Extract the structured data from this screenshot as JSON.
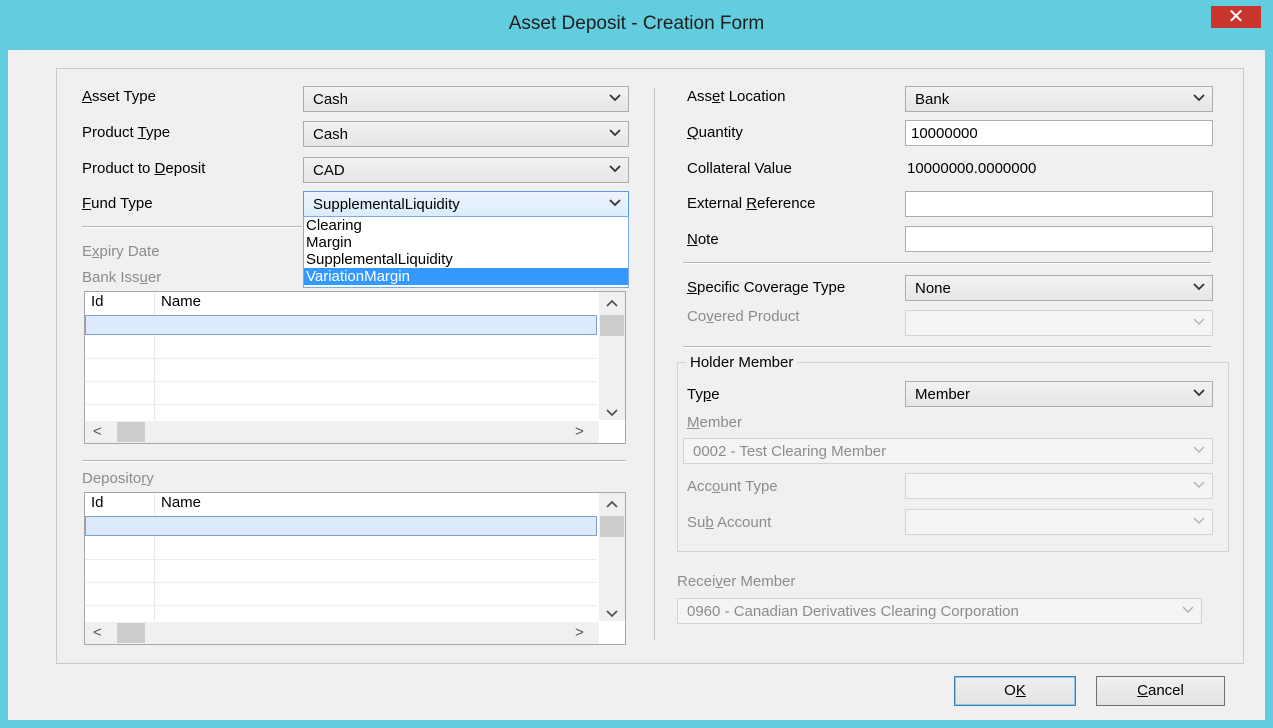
{
  "window": {
    "title": "Asset Deposit - Creation Form",
    "close_glyph": "✕"
  },
  "left": {
    "asset_type": {
      "label_pre": "",
      "label_key": "A",
      "label_post": "sset Type",
      "value": "Cash"
    },
    "product_type": {
      "label_pre": "Product ",
      "label_key": "T",
      "label_post": "ype",
      "value": "Cash"
    },
    "product_to_deposit": {
      "label_pre": "Product to ",
      "label_key": "D",
      "label_post": "eposit",
      "value": "CAD"
    },
    "fund_type": {
      "label_pre": "",
      "label_key": "F",
      "label_post": "und Type",
      "value": "SupplementalLiquidity",
      "options": [
        "Clearing",
        "Margin",
        "SupplementalLiquidity",
        "VariationMargin"
      ],
      "selected_option": "VariationMargin"
    },
    "expiry_date": {
      "label_pre": "E",
      "label_key": "x",
      "label_post": "piry Date"
    },
    "bank_issuer": {
      "label_pre": "Bank Iss",
      "label_key": "u",
      "label_post": "er",
      "col_id": "Id",
      "col_name": "Name"
    },
    "depository": {
      "label_pre": "Deposito",
      "label_key": "r",
      "label_post": "y",
      "col_id": "Id",
      "col_name": "Name"
    }
  },
  "right": {
    "asset_location": {
      "label_pre": "Ass",
      "label_key": "e",
      "label_post": "t Location",
      "value": "Bank"
    },
    "quantity": {
      "label_pre": "",
      "label_key": "Q",
      "label_post": "uantity",
      "value": "10000000"
    },
    "collateral_value": {
      "label": "Collateral Value",
      "value": "10000000.0000000"
    },
    "external_reference": {
      "label_pre": "External ",
      "label_key": "R",
      "label_post": "eference",
      "value": ""
    },
    "note": {
      "label_pre": "",
      "label_key": "N",
      "label_post": "ote",
      "value": ""
    },
    "specific_coverage_type": {
      "label_pre": "",
      "label_key": "S",
      "label_post": "pecific Coverage Type",
      "value": "None"
    },
    "covered_product": {
      "label_pre": "Co",
      "label_key": "v",
      "label_post": "ered Product",
      "value": ""
    },
    "holder_member": {
      "legend": "Holder Member",
      "type": {
        "label_pre": "Ty",
        "label_key": "p",
        "label_post": "e",
        "value": "Member"
      },
      "member": {
        "label_pre": "",
        "label_key": "M",
        "label_post": "ember",
        "value": "0002 - Test Clearing Member"
      },
      "account_type": {
        "label_pre": "Acc",
        "label_key": "o",
        "label_post": "unt Type",
        "value": ""
      },
      "sub_account": {
        "label_pre": "Su",
        "label_key": "b",
        "label_post": " Account",
        "value": ""
      }
    },
    "receiver_member": {
      "label_pre": "Recei",
      "label_key": "v",
      "label_post": "er Member",
      "value": "0960 - Canadian Derivatives Clearing Corporation"
    }
  },
  "buttons": {
    "ok": {
      "pre": "O",
      "key": "K",
      "post": ""
    },
    "cancel": {
      "pre": "",
      "key": "C",
      "post": "ancel"
    }
  },
  "icons": {
    "chevron_down": "﹀",
    "up": "▲",
    "down": "▼",
    "left": "<",
    "right": ">"
  }
}
